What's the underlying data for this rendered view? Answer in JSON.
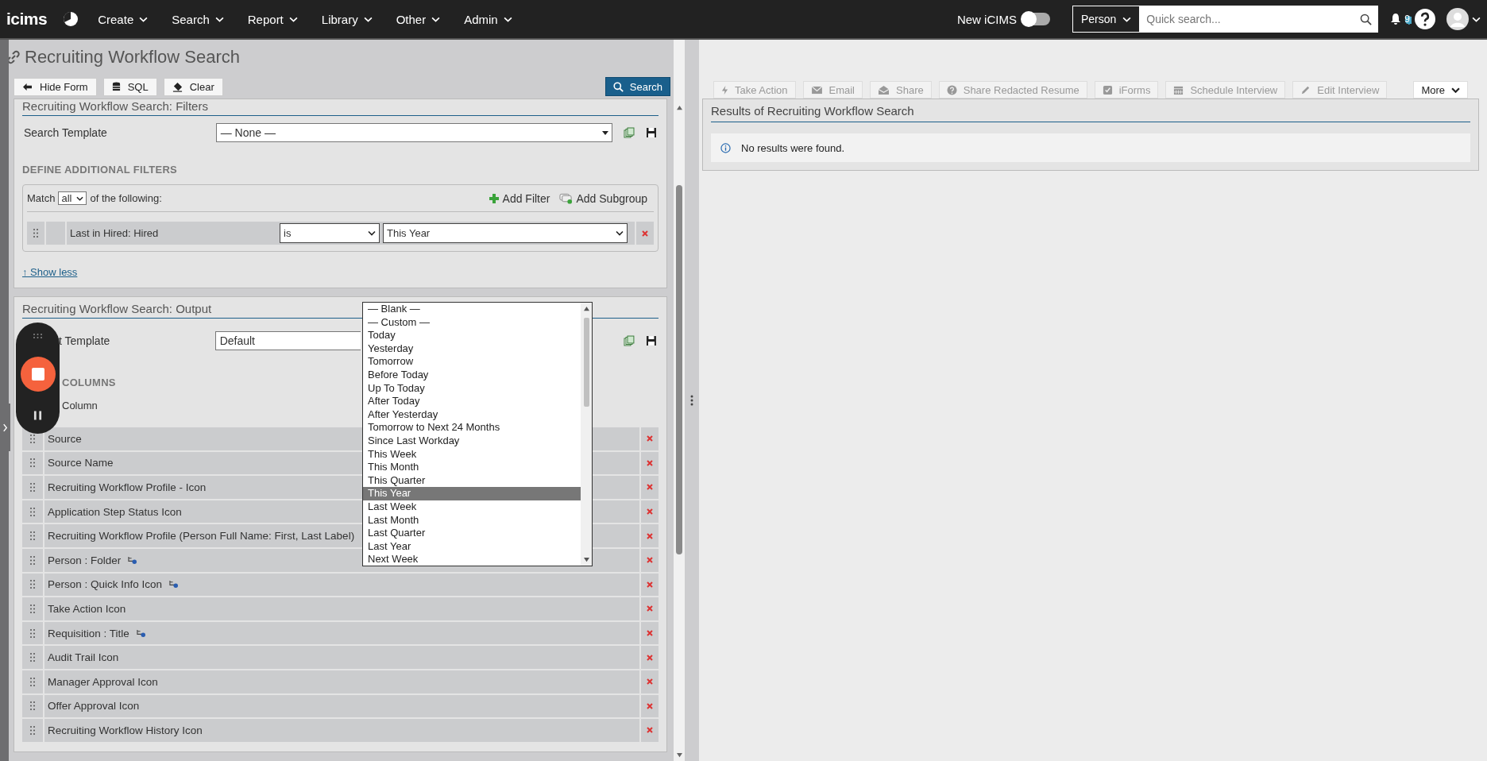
{
  "topnav": {
    "logo": "icims",
    "menus": [
      "Create",
      "Search",
      "Report",
      "Library",
      "Other",
      "Admin"
    ],
    "new_icims": {
      "label": "New iCIMS",
      "on": false
    },
    "search_scope": "Person",
    "search": {
      "placeholder": "Quick search..."
    },
    "notification_count": "9"
  },
  "page_title": "Recruiting Workflow Search",
  "form_toolbar": {
    "buttons": [
      {
        "label": "Hide Form",
        "kind": "back"
      },
      {
        "label": "SQL",
        "kind": "sql"
      },
      {
        "label": "Clear",
        "kind": "clear"
      }
    ],
    "search_button": "Search"
  },
  "filters": {
    "title": "Recruiting Workflow Search: Filters",
    "template_label": "Search Template",
    "template_value": "— None —",
    "heading": "DEFINE ADDITIONAL FILTERS",
    "match_prefix": "Match",
    "match_value": "all",
    "match_suffix": "of the following:",
    "add_filter": "Add Filter",
    "add_subgroup": "Add Subgroup",
    "rows": [
      {
        "field": "Last in Hired: Hired",
        "operator": "is",
        "value": "This Year"
      }
    ],
    "show_less": "↑ Show less"
  },
  "output": {
    "title": "Recruiting Workflow Search: Output",
    "template_label": "t Template",
    "template_value": "Default",
    "heading": "COLUMNS",
    "add_column": "Column",
    "columns": [
      {
        "label": "Source",
        "path_icon": false
      },
      {
        "label": "Source Name",
        "path_icon": false
      },
      {
        "label": "Recruiting Workflow Profile - Icon",
        "path_icon": false
      },
      {
        "label": "Application Step Status Icon",
        "path_icon": false
      },
      {
        "label": "Recruiting Workflow Profile (Person Full Name: First, Last Label)",
        "path_icon": false
      },
      {
        "label": "Person : Folder",
        "path_icon": true
      },
      {
        "label": "Person : Quick Info Icon",
        "path_icon": true
      },
      {
        "label": "Take Action Icon",
        "path_icon": false
      },
      {
        "label": "Requisition : Title",
        "path_icon": true
      },
      {
        "label": "Audit Trail Icon",
        "path_icon": false
      },
      {
        "label": "Manager Approval Icon",
        "path_icon": false
      },
      {
        "label": "Offer Approval Icon",
        "path_icon": false
      },
      {
        "label": "Recruiting Workflow History Icon",
        "path_icon": false
      }
    ]
  },
  "dropdown": {
    "options": [
      {
        "label": "— Blank —",
        "selected": false
      },
      {
        "label": "— Custom —",
        "selected": false
      },
      {
        "label": "Today",
        "selected": false
      },
      {
        "label": "Yesterday",
        "selected": false
      },
      {
        "label": "Tomorrow",
        "selected": false
      },
      {
        "label": "Before Today",
        "selected": false
      },
      {
        "label": "Up To Today",
        "selected": false
      },
      {
        "label": "After Today",
        "selected": false
      },
      {
        "label": "After Yesterday",
        "selected": false
      },
      {
        "label": "Tomorrow to Next 24 Months",
        "selected": false
      },
      {
        "label": "Since Last Workday",
        "selected": false
      },
      {
        "label": "This Week",
        "selected": false
      },
      {
        "label": "This Month",
        "selected": false
      },
      {
        "label": "This Quarter",
        "selected": false
      },
      {
        "label": "This Year",
        "selected": true
      },
      {
        "label": "Last Week",
        "selected": false
      },
      {
        "label": "Last Month",
        "selected": false
      },
      {
        "label": "Last Quarter",
        "selected": false
      },
      {
        "label": "Last Year",
        "selected": false
      },
      {
        "label": "Next Week",
        "selected": false
      }
    ]
  },
  "results_toolbar": {
    "actions": [
      {
        "label": "Take Action",
        "kind": "bolt",
        "disabled": true
      },
      {
        "label": "Email",
        "kind": "mail",
        "disabled": true
      },
      {
        "label": "Share",
        "kind": "share",
        "disabled": true
      },
      {
        "label": "Share Redacted Resume",
        "kind": "help",
        "disabled": true
      },
      {
        "label": "iForms",
        "kind": "form",
        "disabled": true
      },
      {
        "label": "Schedule Interview",
        "kind": "calendar",
        "disabled": true
      },
      {
        "label": "Edit Interview",
        "kind": "pencil",
        "disabled": true
      }
    ],
    "more": "More"
  },
  "results": {
    "title": "Results of Recruiting Workflow Search",
    "message": "No results were found."
  }
}
